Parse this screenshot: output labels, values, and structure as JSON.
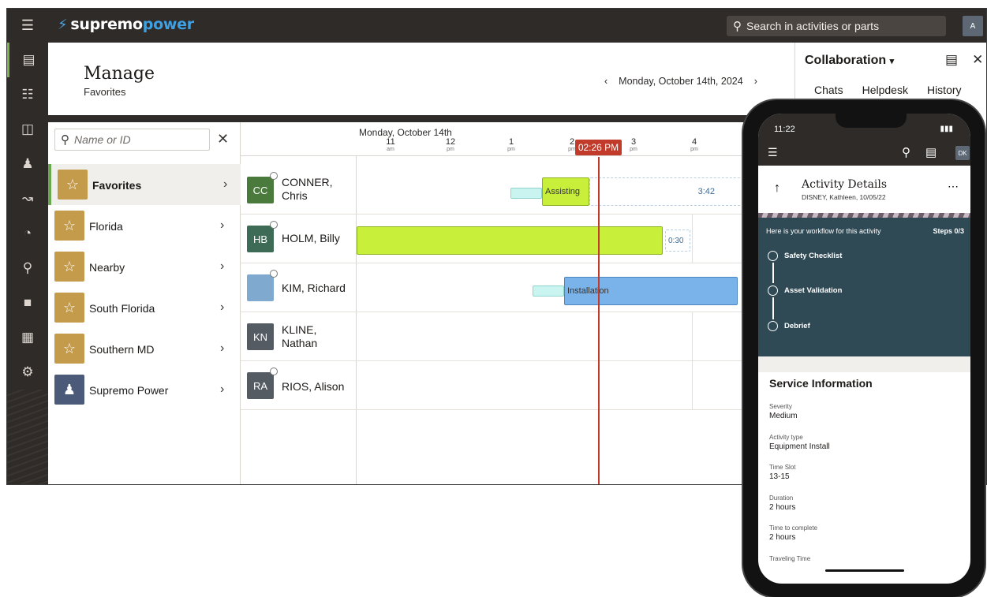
{
  "app": {
    "name_main": "supremo",
    "name_accent": "power"
  },
  "search": {
    "placeholder": "Search in activities or parts"
  },
  "user": {
    "initial": "A"
  },
  "header": {
    "title": "Manage",
    "subtitle": "Favorites",
    "date": "Monday, October 14th, 2024"
  },
  "favorites": {
    "search_placeholder": "Name or ID",
    "items": [
      {
        "label": "Favorites",
        "icon": "star-icon",
        "selected": true
      },
      {
        "label": "Florida",
        "icon": "star-icon"
      },
      {
        "label": "Nearby",
        "icon": "star-icon"
      },
      {
        "label": "South Florida",
        "icon": "star-icon"
      },
      {
        "label": "Southern MD",
        "icon": "star-icon"
      },
      {
        "label": "Supremo Power",
        "icon": "group-icon"
      }
    ]
  },
  "gantt": {
    "date_label": "Monday, October 14th",
    "ticks": [
      {
        "hour": "11",
        "ampm": "am"
      },
      {
        "hour": "12",
        "ampm": "pm"
      },
      {
        "hour": "1",
        "ampm": "pm"
      },
      {
        "hour": "2",
        "ampm": "pm"
      },
      {
        "hour": "3",
        "ampm": "pm"
      },
      {
        "hour": "4",
        "ampm": "pm"
      }
    ],
    "now_label": "02:26 PM",
    "resources": [
      {
        "initials": "CC",
        "name": "CONNER, Chris",
        "color": "#4a7a3c"
      },
      {
        "initials": "HB",
        "name": "HOLM, Billy",
        "color": "#3d6b55"
      },
      {
        "initials": "",
        "name": "KIM, Richard",
        "color": "#7fa9cf"
      },
      {
        "initials": "KN",
        "name": "KLINE, Nathan",
        "color": "#555b63"
      },
      {
        "initials": "RA",
        "name": "RIOS, Alison",
        "color": "#555b63"
      }
    ],
    "activities": {
      "assisting": "Assisting",
      "conner_duration": "3:42",
      "holm_duration": "0:30",
      "installation": "Installation"
    }
  },
  "collab": {
    "title": "Collaboration",
    "tabs": [
      "Chats",
      "Helpdesk",
      "History"
    ]
  },
  "phone": {
    "time": "11:22",
    "user_initials": "DK",
    "title": "Activity Details",
    "subtitle": "DISNEY, Kathleen, 10/05/22",
    "workflow_intro": "Here is your workflow for this activity",
    "steps_label": "Steps 0/3",
    "steps": [
      "Safety Checklist",
      "Asset Validation",
      "Debrief"
    ],
    "service_title": "Service Information",
    "fields": [
      {
        "label": "Severity",
        "value": "Medium"
      },
      {
        "label": "Activity type",
        "value": "Equipment Install"
      },
      {
        "label": "Time Slot",
        "value": "13-15"
      },
      {
        "label": "Duration",
        "value": "2 hours"
      },
      {
        "label": "Time to complete",
        "value": "2 hours"
      },
      {
        "label": "Traveling Time",
        "value": ""
      }
    ]
  }
}
